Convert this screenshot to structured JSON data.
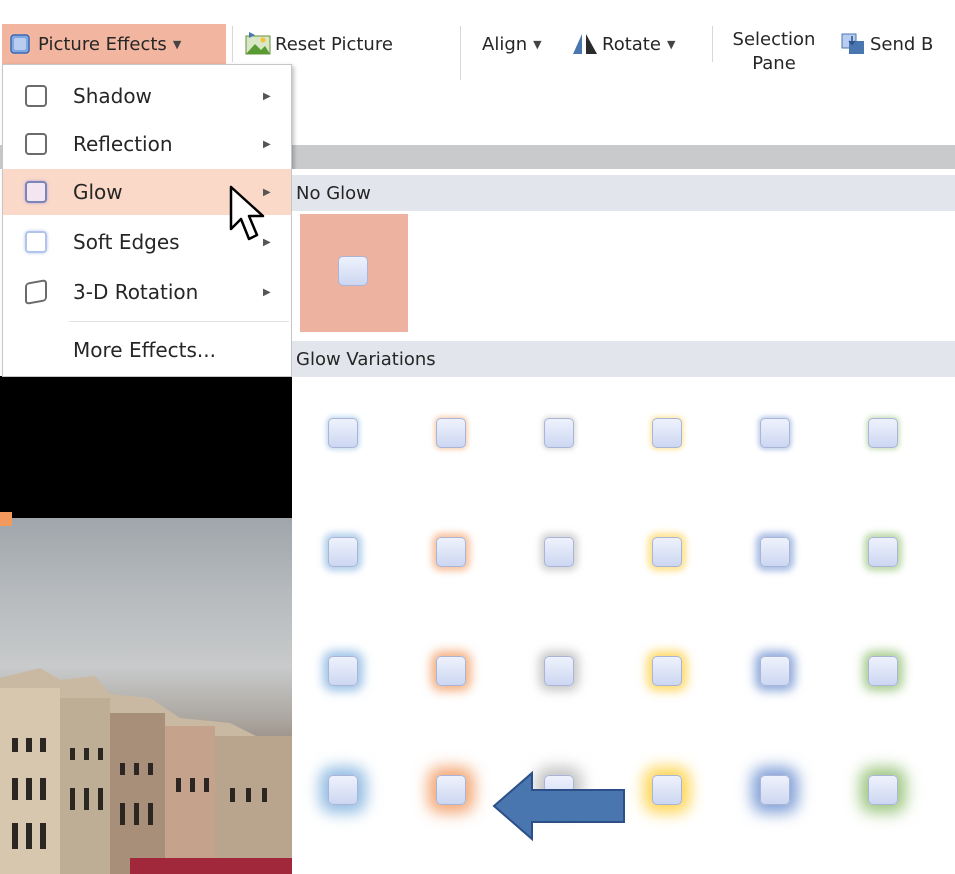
{
  "ribbon": {
    "picture_effects_label": "Picture Effects",
    "reset_picture_label": "Reset Picture",
    "align_label": "Align",
    "rotate_label": "Rotate",
    "selection_pane_line1": "Selection",
    "selection_pane_line2": "Pane",
    "send_backward_label": "Send B"
  },
  "menu": {
    "items": [
      {
        "label": "Shadow",
        "icon": "shadow-icon",
        "has_submenu": true
      },
      {
        "label": "Reflection",
        "icon": "reflection-icon",
        "has_submenu": true
      },
      {
        "label": "Glow",
        "icon": "glow-icon",
        "has_submenu": true,
        "active": true
      },
      {
        "label": "Soft Edges",
        "icon": "soft-edges-icon",
        "has_submenu": true
      },
      {
        "label": "3-D Rotation",
        "icon": "rotation-3d-icon",
        "has_submenu": true
      },
      {
        "label": "More Effects...",
        "icon": "",
        "has_submenu": false
      }
    ]
  },
  "gallery": {
    "no_glow_header": "No Glow",
    "variations_header": "Glow Variations",
    "accent_colors": [
      "#5b9bd5",
      "#ed7d31",
      "#a5a5a5",
      "#ffc000",
      "#4472c4",
      "#70ad47"
    ],
    "glow_sizes": [
      "5 pt",
      "8 pt",
      "11 pt",
      "18 pt"
    ],
    "highlighted_row": 4,
    "highlighted_column": 2
  },
  "colors": {
    "active_button": "#f1b5a0",
    "active_menu_item": "#fbd9c9",
    "selected_swatch_cell": "#eeb3a0",
    "section_header": "#e2e5ec",
    "annotation_arrow": "#4a76b0"
  }
}
